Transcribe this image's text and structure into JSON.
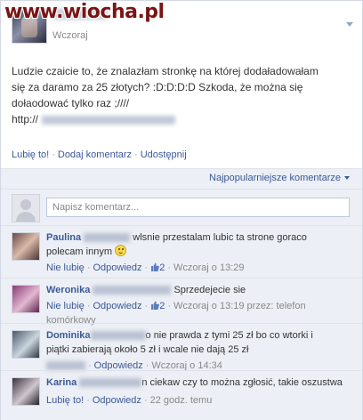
{
  "watermark": "www.wiocha.pl",
  "post": {
    "time": "Wczoraj",
    "text_lines": [
      "Ludzie czaicie to, że znalazłam stronkę na której dodaładowałam",
      "się za daramo za 25 złotych? :D:D:D:D Szkoda, że można się",
      "dołaodować tylko raz ;////",
      "http://"
    ]
  },
  "actions": {
    "like": "Lubię to!",
    "comment": "Dodaj komentarz",
    "share": "Udostępnij",
    "separator": "·"
  },
  "comments_panel": {
    "sort_label": "Najpopularniejsze komentarze",
    "input_placeholder": "Napisz komentarz...",
    "comments": [
      {
        "name": "Paulina",
        "text_line1": "wlsnie przestalam lubic ta strone goraco",
        "text_line2": "polecam innym",
        "meta_unlike": "Nie lubię",
        "meta_reply": "Odpowiedz",
        "likes": "2",
        "time": "Wczoraj o 13:29",
        "avatar_colors": [
          "#6b4a4a",
          "#d9b9a8"
        ]
      },
      {
        "name": "Weronika",
        "text_line1": "Sprzedejecie sie",
        "meta_unlike": "Nie lubię",
        "meta_reply": "Odpowiedz",
        "likes": "2",
        "time": "Wczoraj o 13:19 przez: telefon",
        "time_line2": "komórkowy",
        "avatar_colors": [
          "#8a3a7a",
          "#e3b8d0"
        ]
      },
      {
        "name": "Dominika",
        "text_line1": "o nie prawda z tymi 25 zł bo co wtorki i",
        "text_line2": "piątki zabierają około 5 zł i wcale nie dają 25 zł",
        "meta_reply": "Odpowiedz",
        "time": "Wczoraj o 14:34",
        "avatar_colors": [
          "#4d5a6a",
          "#c9d4de"
        ]
      },
      {
        "name": "Karina",
        "text_line1": "n ciekaw czy to można zgłosić, takie oszustwa",
        "meta_like": "Lubię to!",
        "meta_reply": "Odpowiedz",
        "time": "22 godz. temu",
        "avatar_colors": [
          "#3a3440",
          "#cfc6cf"
        ]
      }
    ]
  },
  "colors": {
    "link": "#3b5998",
    "panel_bg": "#eceff5",
    "watermark": "#7a1414"
  }
}
